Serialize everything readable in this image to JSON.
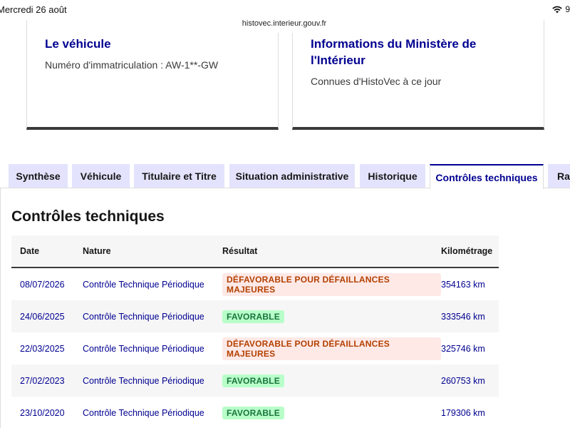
{
  "status_bar": {
    "date": "Mercredi 26 août",
    "battery": "9"
  },
  "browser": {
    "url": "histovec.interieur.gouv.fr"
  },
  "cards": {
    "vehicle": {
      "title": "Le véhicule",
      "text": "Numéro d'immatriculation : AW-1**-GW"
    },
    "ministry": {
      "title_line1": "Informations du Ministère de",
      "title_line2": "l'Intérieur",
      "text": "Connues d'HistoVec à ce jour"
    }
  },
  "tabs": [
    {
      "label": "Synthèse"
    },
    {
      "label": "Véhicule"
    },
    {
      "label": "Titulaire et Titre"
    },
    {
      "label": "Situation administrative"
    },
    {
      "label": "Historique"
    },
    {
      "label": "Contrôles techniques"
    },
    {
      "label": "Rap"
    }
  ],
  "active_tab": "Contrôles techniques",
  "section": {
    "title": "Contrôles techniques"
  },
  "table": {
    "headers": {
      "date": "Date",
      "nature": "Nature",
      "result": "Résultat",
      "km": "Kilométrage"
    },
    "rows": [
      {
        "date": "08/07/2026",
        "nature": "Contrôle Technique Périodique",
        "result": "DÉFAVORABLE POUR DÉFAILLANCES MAJEURES",
        "status": "bad",
        "km": "354163 km"
      },
      {
        "date": "24/06/2025",
        "nature": "Contrôle Technique Périodique",
        "result": "FAVORABLE",
        "status": "good",
        "km": "333546 km"
      },
      {
        "date": "22/03/2025",
        "nature": "Contrôle Technique Périodique",
        "result": "DÉFAVORABLE POUR DÉFAILLANCES MAJEURES",
        "status": "bad",
        "km": "325746 km"
      },
      {
        "date": "27/02/2023",
        "nature": "Contrôle Technique Périodique",
        "result": "FAVORABLE",
        "status": "good",
        "km": "260753 km"
      },
      {
        "date": "23/10/2020",
        "nature": "Contrôle Technique Périodique",
        "result": "FAVORABLE",
        "status": "good",
        "km": "179306 km"
      }
    ]
  },
  "colors": {
    "brand_blue": "#000091",
    "tab_bg": "#e3e3fd",
    "bad_bg": "#fee9e7",
    "bad_fg": "#b34000",
    "good_bg": "#b8fec9",
    "good_fg": "#18753c"
  }
}
